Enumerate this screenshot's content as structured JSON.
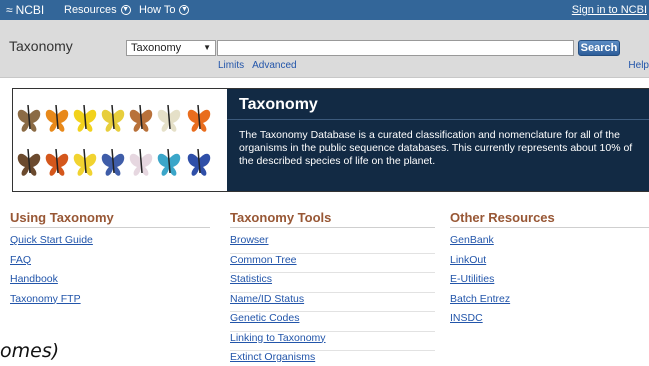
{
  "topbar": {
    "logo": "NCBI",
    "resources": "Resources",
    "howto": "How To",
    "signin": "Sign in to NCBI"
  },
  "search": {
    "db_title": "Taxonomy",
    "db_selected": "Taxonomy",
    "query": "",
    "button": "Search",
    "limits": "Limits",
    "advanced": "Advanced",
    "help": "Help"
  },
  "hero": {
    "title": "Taxonomy",
    "description": "The Taxonomy Database is a curated classification and nomenclature for all of the organisms in the public sequence databases. This currently represents about 10% of the described species of life on the planet."
  },
  "columns": [
    {
      "heading": "Using Taxonomy",
      "items": [
        "Quick Start Guide",
        "FAQ",
        "Handbook",
        "Taxonomy FTP"
      ]
    },
    {
      "heading": "Taxonomy Tools",
      "items": [
        "Browser",
        "Common Tree",
        "Statistics",
        "Name/ID Status",
        "Genetic Codes",
        "Linking to Taxonomy",
        "Extinct Organisms"
      ]
    },
    {
      "heading": "Other Resources",
      "items": [
        "GenBank",
        "LinkOut",
        "E-Utilities",
        "Batch Entrez",
        "INSDC"
      ]
    }
  ],
  "overlay": "omes)"
}
